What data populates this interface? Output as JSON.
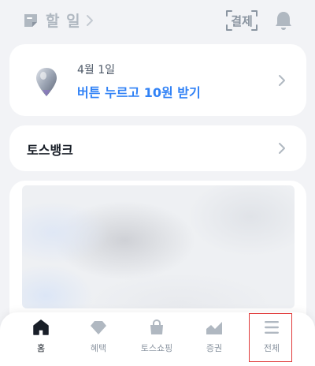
{
  "header": {
    "todo_label": "할 일",
    "pay_label": "결제"
  },
  "reward": {
    "date": "4월 1일",
    "title": "버튼 누르고 10원 받기"
  },
  "bank": {
    "title": "토스뱅크"
  },
  "tabs": [
    {
      "label": "홈",
      "icon": "home-icon",
      "active": true
    },
    {
      "label": "혜택",
      "icon": "gem-icon",
      "active": false
    },
    {
      "label": "토스쇼핑",
      "icon": "shopping-bag-icon",
      "active": false
    },
    {
      "label": "증권",
      "icon": "stock-chart-icon",
      "active": false
    },
    {
      "label": "전체",
      "icon": "menu-icon",
      "active": false
    }
  ],
  "colors": {
    "accent": "#3182f6",
    "background": "#f2f3f6",
    "muted": "#b0b8c1"
  }
}
